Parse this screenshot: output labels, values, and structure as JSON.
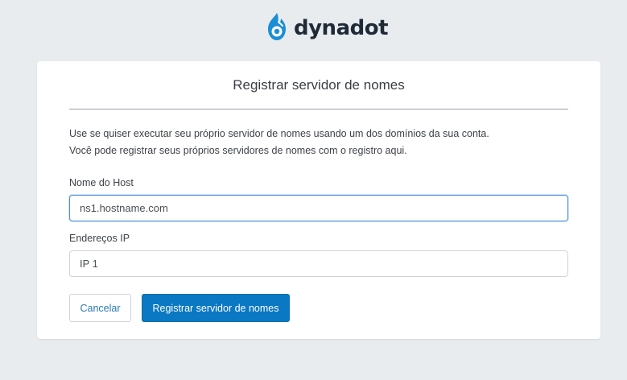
{
  "brand": {
    "name": "dynadot",
    "logo_icon": "dynadot-flame-icon",
    "accent_color": "#1a8fd6",
    "text_color": "#1f2a37"
  },
  "form": {
    "title": "Registrar servidor de nomes",
    "description_line1": "Use se quiser executar seu próprio servidor de nomes usando um dos domínios da sua conta.",
    "description_line2": "Você pode registrar seus próprios servidores de nomes com o registro aqui.",
    "host_label": "Nome do Host",
    "host_placeholder": "ns1.hostname.com",
    "host_value": "",
    "ip_label": "Endereços IP",
    "ip_placeholder": "IP 1",
    "ip_value": "",
    "cancel_label": "Cancelar",
    "submit_label": "Registrar servidor de nomes"
  },
  "colors": {
    "background": "#e9ecef",
    "primary_button": "#0a78c2",
    "focus_border": "#4a90d9"
  }
}
